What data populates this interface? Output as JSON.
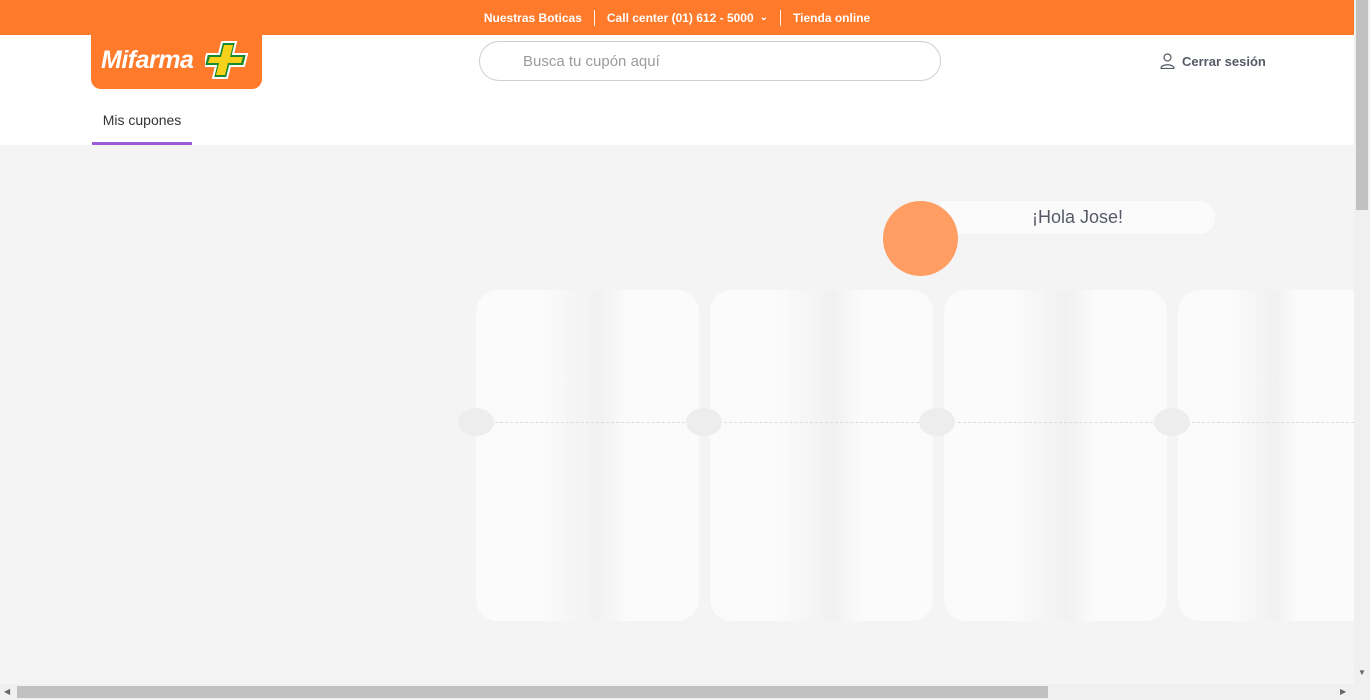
{
  "topbar": {
    "stores_label": "Nuestras Boticas",
    "callcenter_label": "Call center (01) 612 - 5000",
    "store_online_label": "Tienda online",
    "background": "#ff7a2a"
  },
  "header": {
    "logo_text": "Mifarma",
    "search_placeholder": "Busca tu cupón aquí",
    "logout_label": "Cerrar sesión",
    "tab_label": "Mis cupones",
    "tab_accent": "#9c5bd6"
  },
  "main": {
    "greeting": "¡Hola Jose!",
    "avatar_color": "#ff9d62",
    "coupon_cards": 4
  },
  "icons": {
    "chevron": "chevron-down-icon",
    "user": "user-icon",
    "cross": "plus-cross-icon"
  }
}
